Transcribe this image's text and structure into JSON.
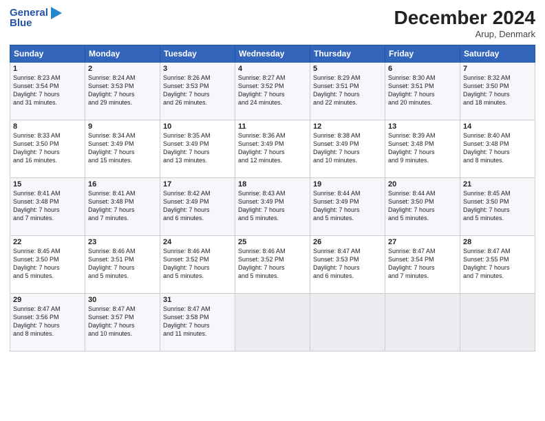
{
  "header": {
    "logo_line1": "General",
    "logo_line2": "Blue",
    "month": "December 2024",
    "location": "Arup, Denmark"
  },
  "weekdays": [
    "Sunday",
    "Monday",
    "Tuesday",
    "Wednesday",
    "Thursday",
    "Friday",
    "Saturday"
  ],
  "weeks": [
    [
      {
        "day": "1",
        "lines": [
          "Sunrise: 8:23 AM",
          "Sunset: 3:54 PM",
          "Daylight: 7 hours",
          "and 31 minutes."
        ]
      },
      {
        "day": "2",
        "lines": [
          "Sunrise: 8:24 AM",
          "Sunset: 3:53 PM",
          "Daylight: 7 hours",
          "and 29 minutes."
        ]
      },
      {
        "day": "3",
        "lines": [
          "Sunrise: 8:26 AM",
          "Sunset: 3:53 PM",
          "Daylight: 7 hours",
          "and 26 minutes."
        ]
      },
      {
        "day": "4",
        "lines": [
          "Sunrise: 8:27 AM",
          "Sunset: 3:52 PM",
          "Daylight: 7 hours",
          "and 24 minutes."
        ]
      },
      {
        "day": "5",
        "lines": [
          "Sunrise: 8:29 AM",
          "Sunset: 3:51 PM",
          "Daylight: 7 hours",
          "and 22 minutes."
        ]
      },
      {
        "day": "6",
        "lines": [
          "Sunrise: 8:30 AM",
          "Sunset: 3:51 PM",
          "Daylight: 7 hours",
          "and 20 minutes."
        ]
      },
      {
        "day": "7",
        "lines": [
          "Sunrise: 8:32 AM",
          "Sunset: 3:50 PM",
          "Daylight: 7 hours",
          "and 18 minutes."
        ]
      }
    ],
    [
      {
        "day": "8",
        "lines": [
          "Sunrise: 8:33 AM",
          "Sunset: 3:50 PM",
          "Daylight: 7 hours",
          "and 16 minutes."
        ]
      },
      {
        "day": "9",
        "lines": [
          "Sunrise: 8:34 AM",
          "Sunset: 3:49 PM",
          "Daylight: 7 hours",
          "and 15 minutes."
        ]
      },
      {
        "day": "10",
        "lines": [
          "Sunrise: 8:35 AM",
          "Sunset: 3:49 PM",
          "Daylight: 7 hours",
          "and 13 minutes."
        ]
      },
      {
        "day": "11",
        "lines": [
          "Sunrise: 8:36 AM",
          "Sunset: 3:49 PM",
          "Daylight: 7 hours",
          "and 12 minutes."
        ]
      },
      {
        "day": "12",
        "lines": [
          "Sunrise: 8:38 AM",
          "Sunset: 3:49 PM",
          "Daylight: 7 hours",
          "and 10 minutes."
        ]
      },
      {
        "day": "13",
        "lines": [
          "Sunrise: 8:39 AM",
          "Sunset: 3:48 PM",
          "Daylight: 7 hours",
          "and 9 minutes."
        ]
      },
      {
        "day": "14",
        "lines": [
          "Sunrise: 8:40 AM",
          "Sunset: 3:48 PM",
          "Daylight: 7 hours",
          "and 8 minutes."
        ]
      }
    ],
    [
      {
        "day": "15",
        "lines": [
          "Sunrise: 8:41 AM",
          "Sunset: 3:48 PM",
          "Daylight: 7 hours",
          "and 7 minutes."
        ]
      },
      {
        "day": "16",
        "lines": [
          "Sunrise: 8:41 AM",
          "Sunset: 3:48 PM",
          "Daylight: 7 hours",
          "and 7 minutes."
        ]
      },
      {
        "day": "17",
        "lines": [
          "Sunrise: 8:42 AM",
          "Sunset: 3:49 PM",
          "Daylight: 7 hours",
          "and 6 minutes."
        ]
      },
      {
        "day": "18",
        "lines": [
          "Sunrise: 8:43 AM",
          "Sunset: 3:49 PM",
          "Daylight: 7 hours",
          "and 5 minutes."
        ]
      },
      {
        "day": "19",
        "lines": [
          "Sunrise: 8:44 AM",
          "Sunset: 3:49 PM",
          "Daylight: 7 hours",
          "and 5 minutes."
        ]
      },
      {
        "day": "20",
        "lines": [
          "Sunrise: 8:44 AM",
          "Sunset: 3:50 PM",
          "Daylight: 7 hours",
          "and 5 minutes."
        ]
      },
      {
        "day": "21",
        "lines": [
          "Sunrise: 8:45 AM",
          "Sunset: 3:50 PM",
          "Daylight: 7 hours",
          "and 5 minutes."
        ]
      }
    ],
    [
      {
        "day": "22",
        "lines": [
          "Sunrise: 8:45 AM",
          "Sunset: 3:50 PM",
          "Daylight: 7 hours",
          "and 5 minutes."
        ]
      },
      {
        "day": "23",
        "lines": [
          "Sunrise: 8:46 AM",
          "Sunset: 3:51 PM",
          "Daylight: 7 hours",
          "and 5 minutes."
        ]
      },
      {
        "day": "24",
        "lines": [
          "Sunrise: 8:46 AM",
          "Sunset: 3:52 PM",
          "Daylight: 7 hours",
          "and 5 minutes."
        ]
      },
      {
        "day": "25",
        "lines": [
          "Sunrise: 8:46 AM",
          "Sunset: 3:52 PM",
          "Daylight: 7 hours",
          "and 5 minutes."
        ]
      },
      {
        "day": "26",
        "lines": [
          "Sunrise: 8:47 AM",
          "Sunset: 3:53 PM",
          "Daylight: 7 hours",
          "and 6 minutes."
        ]
      },
      {
        "day": "27",
        "lines": [
          "Sunrise: 8:47 AM",
          "Sunset: 3:54 PM",
          "Daylight: 7 hours",
          "and 7 minutes."
        ]
      },
      {
        "day": "28",
        "lines": [
          "Sunrise: 8:47 AM",
          "Sunset: 3:55 PM",
          "Daylight: 7 hours",
          "and 7 minutes."
        ]
      }
    ],
    [
      {
        "day": "29",
        "lines": [
          "Sunrise: 8:47 AM",
          "Sunset: 3:56 PM",
          "Daylight: 7 hours",
          "and 8 minutes."
        ]
      },
      {
        "day": "30",
        "lines": [
          "Sunrise: 8:47 AM",
          "Sunset: 3:57 PM",
          "Daylight: 7 hours",
          "and 10 minutes."
        ]
      },
      {
        "day": "31",
        "lines": [
          "Sunrise: 8:47 AM",
          "Sunset: 3:58 PM",
          "Daylight: 7 hours",
          "and 11 minutes."
        ]
      },
      null,
      null,
      null,
      null
    ]
  ]
}
